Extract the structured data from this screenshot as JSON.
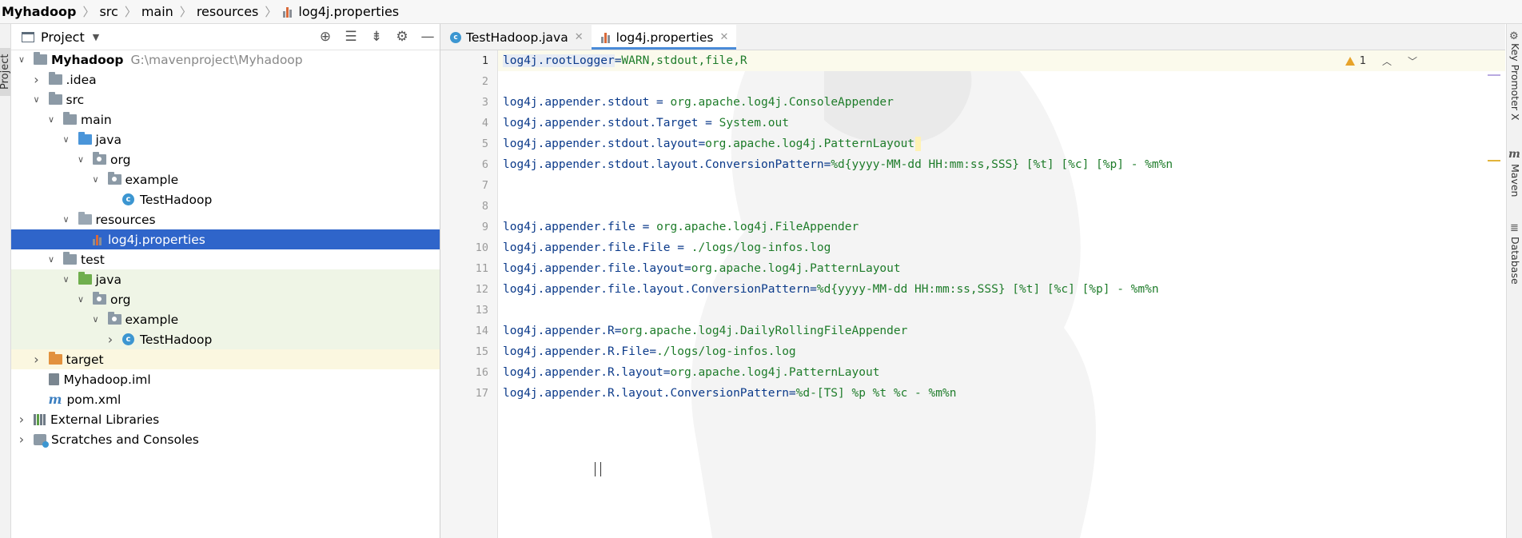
{
  "breadcrumb": [
    "Myhadoop",
    "src",
    "main",
    "resources",
    "log4j.properties"
  ],
  "left_stripe": {
    "label": "Project"
  },
  "project_panel": {
    "title": "Project",
    "tools": [
      "locate-icon",
      "expand-all-icon",
      "collapse-all-icon",
      "settings-icon",
      "minimize-icon"
    ]
  },
  "tree": [
    {
      "name": "Myhadoop",
      "path": "G:\\mavenproject\\Myhadoop",
      "depth": 0,
      "arrow": "open",
      "icon": "module-folder",
      "bold": true
    },
    {
      "name": ".idea",
      "depth": 1,
      "arrow": "closed",
      "icon": "folder"
    },
    {
      "name": "src",
      "depth": 1,
      "arrow": "open",
      "icon": "folder"
    },
    {
      "name": "main",
      "depth": 2,
      "arrow": "open",
      "icon": "folder"
    },
    {
      "name": "java",
      "depth": 3,
      "arrow": "open",
      "icon": "source-folder"
    },
    {
      "name": "org",
      "depth": 4,
      "arrow": "open",
      "icon": "package"
    },
    {
      "name": "example",
      "depth": 5,
      "arrow": "open",
      "icon": "package"
    },
    {
      "name": "TestHadoop",
      "depth": 6,
      "arrow": "none",
      "icon": "class"
    },
    {
      "name": "resources",
      "depth": 3,
      "arrow": "open",
      "icon": "resources-folder"
    },
    {
      "name": "log4j.properties",
      "depth": 4,
      "arrow": "none",
      "icon": "properties",
      "selected": true
    },
    {
      "name": "test",
      "depth": 2,
      "arrow": "open",
      "icon": "folder"
    },
    {
      "name": "java",
      "depth": 3,
      "arrow": "open",
      "icon": "test-folder",
      "test": true
    },
    {
      "name": "org",
      "depth": 4,
      "arrow": "open",
      "icon": "package",
      "test": true
    },
    {
      "name": "example",
      "depth": 5,
      "arrow": "open",
      "icon": "package",
      "test": true
    },
    {
      "name": "TestHadoop",
      "depth": 6,
      "arrow": "closed",
      "icon": "test-class",
      "test": true
    },
    {
      "name": "target",
      "depth": 1,
      "arrow": "closed",
      "icon": "excluded-folder",
      "target": true
    },
    {
      "name": "Myhadoop.iml",
      "depth": 1,
      "arrow": "none",
      "icon": "iml"
    },
    {
      "name": "pom.xml",
      "depth": 1,
      "arrow": "none",
      "icon": "pom"
    },
    {
      "name": "External Libraries",
      "depth": 0,
      "arrow": "closed",
      "icon": "libraries"
    },
    {
      "name": "Scratches and Consoles",
      "depth": 0,
      "arrow": "closed",
      "icon": "scratches"
    }
  ],
  "tabs": [
    {
      "label": "TestHadoop.java",
      "icon": "java-class",
      "active": false
    },
    {
      "label": "log4j.properties",
      "icon": "properties",
      "active": true
    }
  ],
  "inspection": {
    "warnings": "1"
  },
  "code_lines": [
    {
      "n": "1",
      "key": "log4j.rootLogger",
      "sep": "=",
      "val": "WARN,stdout,file,R"
    },
    {
      "n": "2",
      "key": "",
      "sep": "",
      "val": ""
    },
    {
      "n": "3",
      "key": "log4j.appender.stdout",
      "sep": " = ",
      "val": "org.apache.log4j.ConsoleAppender"
    },
    {
      "n": "4",
      "key": "log4j.appender.stdout.Target",
      "sep": " = ",
      "val": "System.out"
    },
    {
      "n": "5",
      "key": "log4j.appender.stdout.layout",
      "sep": "=",
      "val": "org.apache.log4j.PatternLayout"
    },
    {
      "n": "6",
      "key": "log4j.appender.stdout.layout.ConversionPattern",
      "sep": "=",
      "val": "%d{yyyy-MM-dd HH:mm:ss,SSS} [%t] [%c] [%p] - %m%n"
    },
    {
      "n": "7",
      "key": "",
      "sep": "",
      "val": ""
    },
    {
      "n": "8",
      "key": "",
      "sep": "",
      "val": ""
    },
    {
      "n": "9",
      "key": "log4j.appender.file",
      "sep": " = ",
      "val": "org.apache.log4j.FileAppender"
    },
    {
      "n": "10",
      "key": "log4j.appender.file.File",
      "sep": " = ",
      "val": "./logs/log-infos.log"
    },
    {
      "n": "11",
      "key": "log4j.appender.file.layout",
      "sep": "=",
      "val": "org.apache.log4j.PatternLayout"
    },
    {
      "n": "12",
      "key": "log4j.appender.file.layout.ConversionPattern",
      "sep": "=",
      "val": "%d{yyyy-MM-dd HH:mm:ss,SSS} [%t] [%c] [%p] - %m%n"
    },
    {
      "n": "13",
      "key": "",
      "sep": "",
      "val": ""
    },
    {
      "n": "14",
      "key": "log4j.appender.R",
      "sep": "=",
      "val": "org.apache.log4j.DailyRollingFileAppender"
    },
    {
      "n": "15",
      "key": "log4j.appender.R.File",
      "sep": "=",
      "val": "./logs/log-infos.log"
    },
    {
      "n": "16",
      "key": "log4j.appender.R.layout",
      "sep": "=",
      "val": "org.apache.log4j.PatternLayout"
    },
    {
      "n": "17",
      "key": "log4j.appender.R.layout.ConversionPattern",
      "sep": "=",
      "val": "%d-[TS] %p %t %c - %m%n"
    }
  ],
  "right_stripe": [
    "Key Promoter X",
    "Maven",
    "Database"
  ],
  "colors": {
    "selection": "#2f65ca",
    "key": "#0b3a8a",
    "value": "#1e7c2a",
    "test_bg": "#eff5e6",
    "target_bg": "#fbf7e0"
  }
}
